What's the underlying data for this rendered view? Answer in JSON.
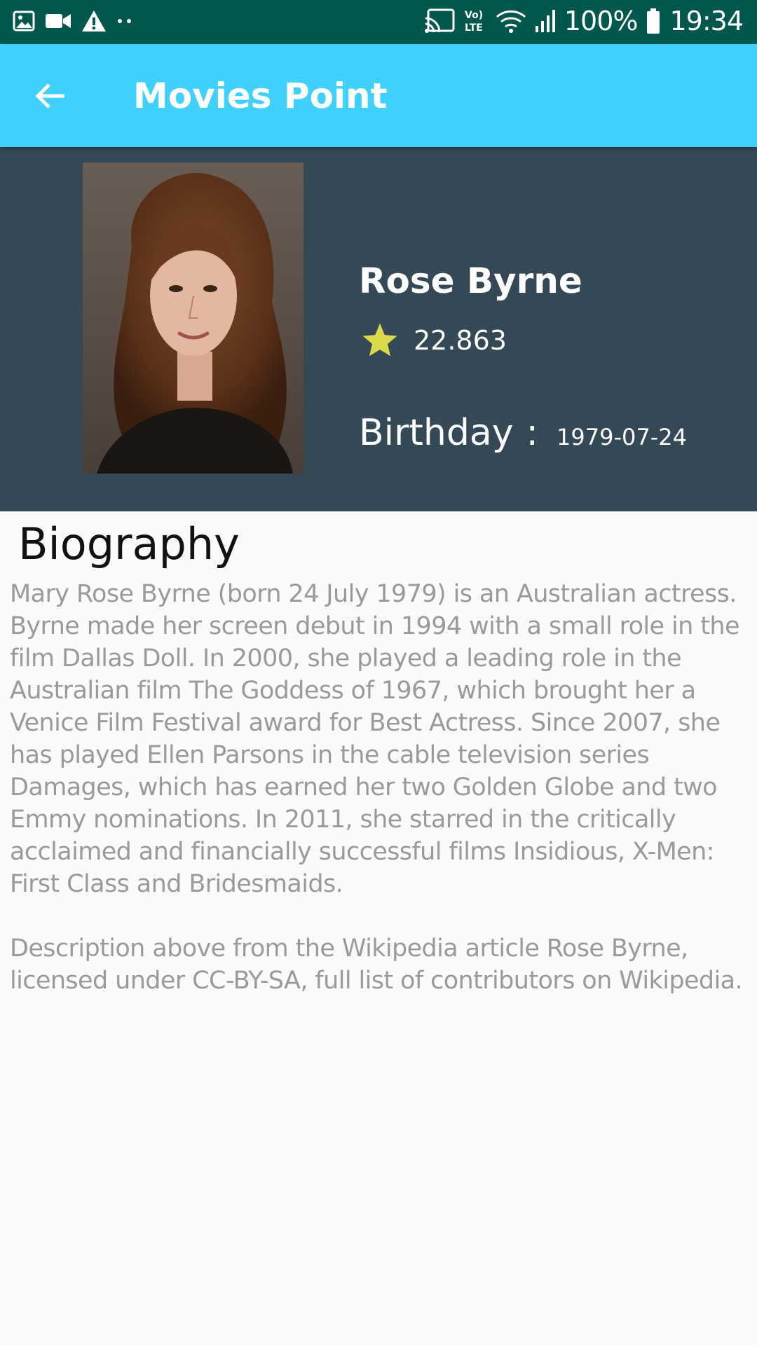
{
  "status_bar": {
    "battery": "100%",
    "time": "19:34",
    "left_icons": [
      "image-icon",
      "video-camera-icon",
      "warning-icon",
      "more-dots-icon"
    ],
    "right_icons": [
      "cast-icon",
      "volte-icon",
      "wifi-icon",
      "signal-icon",
      "battery-icon"
    ],
    "volte_label": "Vo) LTE"
  },
  "app_bar": {
    "title": "Movies Point",
    "back_icon": "arrow-back-icon",
    "background": "#40d0fc"
  },
  "person": {
    "name": "Rose Byrne",
    "rating": "22.863",
    "rating_icon": "star-icon",
    "birthday_label": "Birthday",
    "birthday_separator": ":",
    "birthday": "1979-07-24",
    "portrait_icon": "person-photo"
  },
  "biography": {
    "heading": "Biography",
    "text": "Mary Rose Byrne (born 24 July 1979) is an Australian actress. Byrne made her screen debut in 1994 with a small role in the film Dallas Doll. In 2000, she played a leading role in the Australian film The Goddess of 1967, which brought her a Venice Film Festival award for Best Actress. Since 2007, she has played Ellen Parsons in the cable television series Damages, which has earned her two Golden Globe and two Emmy nominations. In 2011, she starred in the critically acclaimed and financially successful films Insidious, X-Men: First Class and Bridesmaids.\n\nDescription above from the Wikipedia article Rose Byrne, licensed under CC-BY-SA, full list of contributors on Wikipedia."
  },
  "colors": {
    "status_bar": "#00574b",
    "hero_background": "#344955",
    "star": "#d9d94a",
    "bio_text": "#9a9a9a"
  }
}
